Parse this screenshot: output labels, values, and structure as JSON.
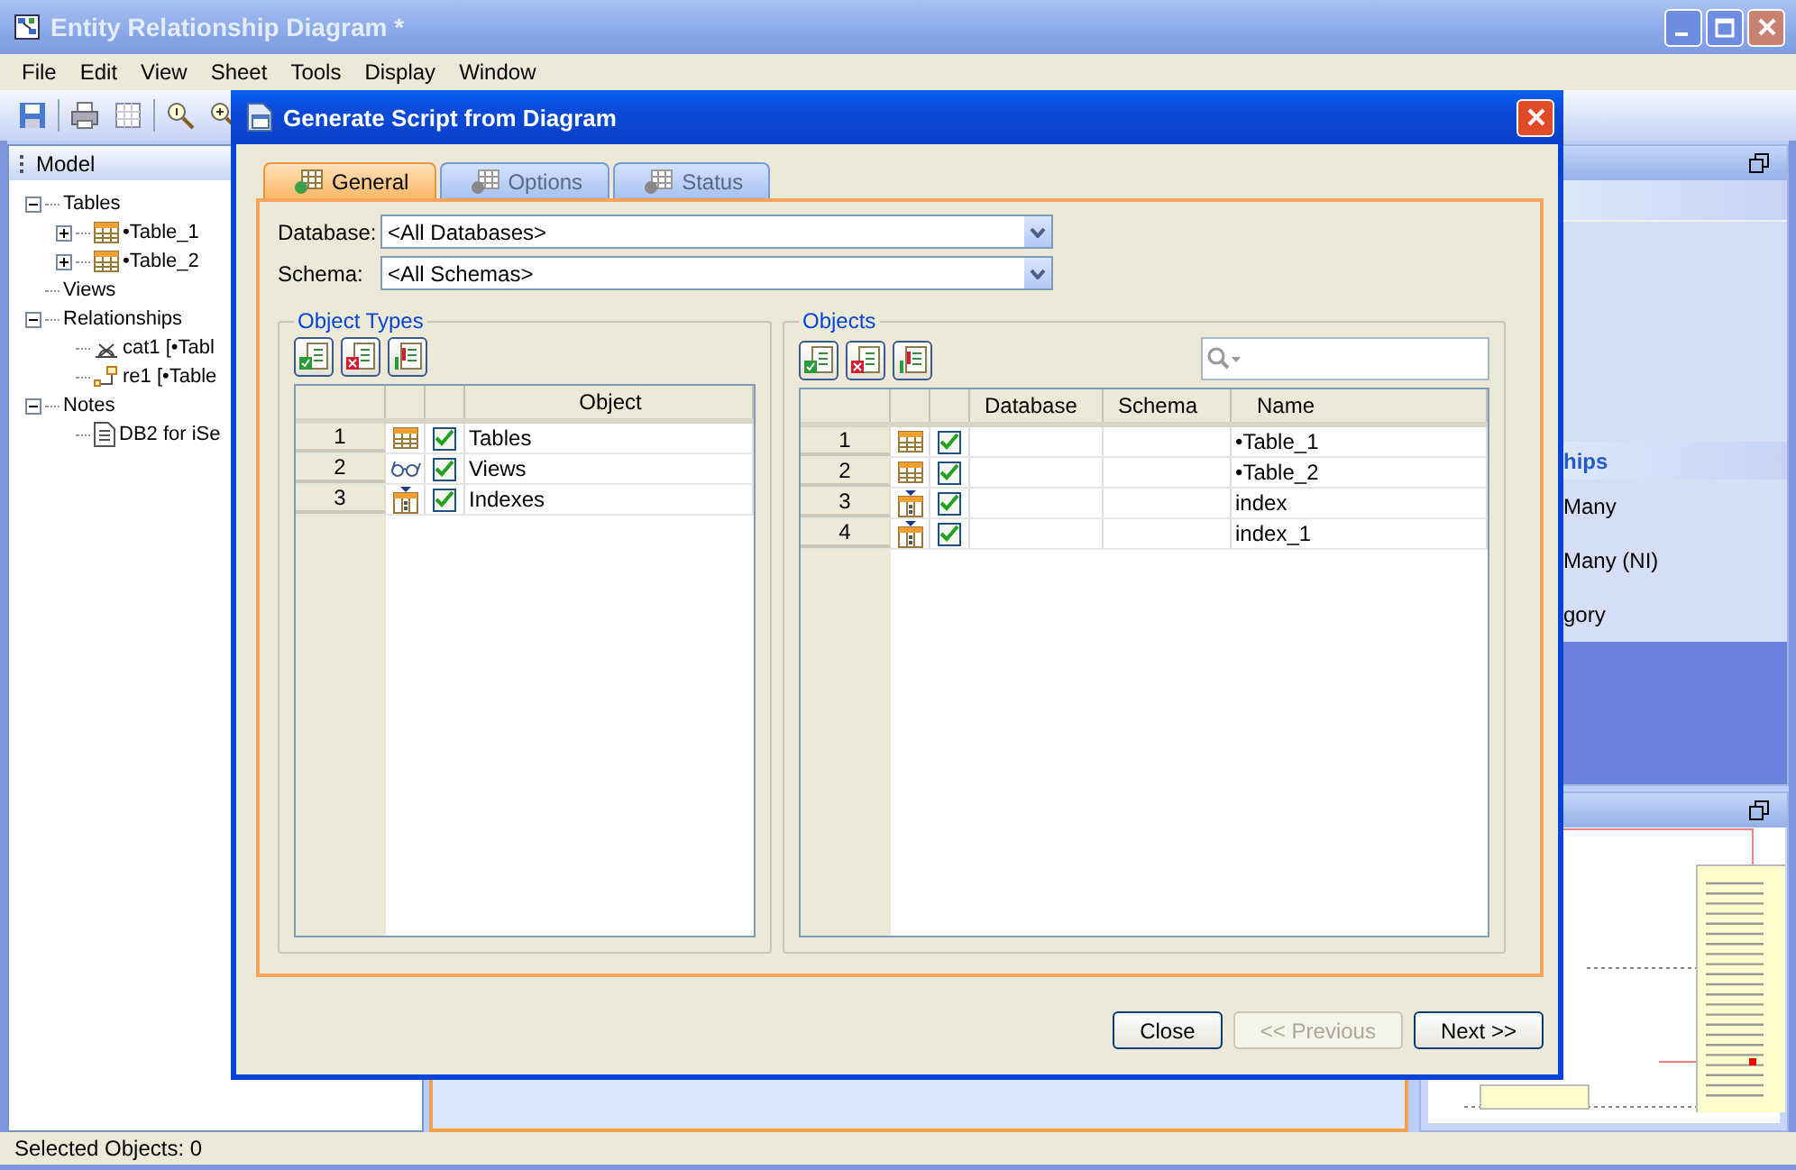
{
  "window": {
    "title": "Entity Relationship Diagram *"
  },
  "menu": [
    "File",
    "Edit",
    "View",
    "Sheet",
    "Tools",
    "Display",
    "Window"
  ],
  "model_panel": {
    "title": "Model",
    "tree": [
      {
        "label": "Tables",
        "expanded": true,
        "children": [
          {
            "label": "•Table_1",
            "kind": "table",
            "expanded": false
          },
          {
            "label": "•Table_2",
            "kind": "table",
            "expanded": false
          }
        ]
      },
      {
        "label": "Views"
      },
      {
        "label": "Relationships",
        "expanded": true,
        "children": [
          {
            "label": "cat1 [•Tabl",
            "kind": "category"
          },
          {
            "label": "re1 [•Table",
            "kind": "relationship"
          }
        ]
      },
      {
        "label": "Notes",
        "expanded": true,
        "children": [
          {
            "label": "DB2 for iSe",
            "kind": "note"
          }
        ]
      }
    ]
  },
  "palette_panel": {
    "section_title": "hips",
    "items": [
      "Many",
      "Many (NI)",
      "gory"
    ]
  },
  "status_bar": "Selected Objects: 0",
  "dialog": {
    "title": "Generate Script from Diagram",
    "tabs": [
      {
        "label": "General",
        "selected": true,
        "disabled": false
      },
      {
        "label": "Options",
        "selected": false,
        "disabled": true
      },
      {
        "label": "Status",
        "selected": false,
        "disabled": true
      }
    ],
    "database": {
      "label": "Database:",
      "value": "<All Databases>"
    },
    "schema": {
      "label": "Schema:",
      "value": "<All Schemas>"
    },
    "object_types": {
      "title": "Object Types",
      "columns": [
        "Object"
      ],
      "rows": [
        {
          "number": "1",
          "kind": "table",
          "checked": true,
          "object": "Tables"
        },
        {
          "number": "2",
          "kind": "view",
          "checked": true,
          "object": "Views"
        },
        {
          "number": "3",
          "kind": "index",
          "checked": true,
          "object": "Indexes"
        }
      ]
    },
    "objects": {
      "title": "Objects",
      "columns": [
        "Database",
        "Schema",
        "Name"
      ],
      "rows": [
        {
          "number": "1",
          "kind": "table",
          "checked": true,
          "name": "•Table_1"
        },
        {
          "number": "2",
          "kind": "table",
          "checked": true,
          "name": "•Table_2"
        },
        {
          "number": "3",
          "kind": "index",
          "checked": true,
          "name": "index"
        },
        {
          "number": "4",
          "kind": "index",
          "checked": true,
          "name": "index_1"
        }
      ]
    },
    "buttons": [
      {
        "label": "Close",
        "disabled": false
      },
      {
        "label": "<< Previous",
        "disabled": true
      },
      {
        "label": "Next >>",
        "disabled": false
      }
    ]
  }
}
